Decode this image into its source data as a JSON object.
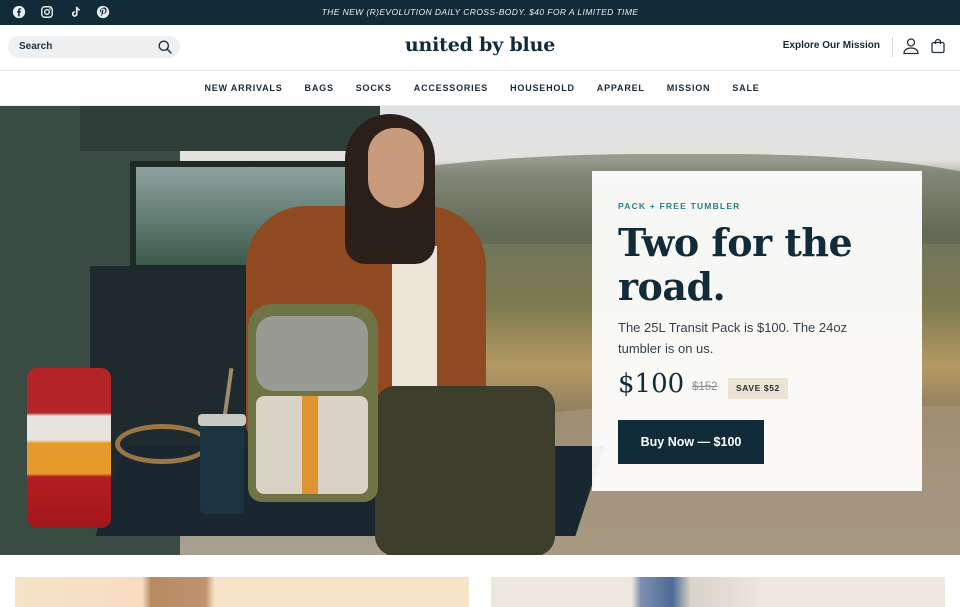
{
  "announcement": {
    "text": "THE NEW (R)EVOLUTION DAILY CROSS-BODY. $40 FOR A LIMITED TIME"
  },
  "social_icons": [
    "facebook-icon",
    "instagram-icon",
    "tiktok-icon",
    "pinterest-icon"
  ],
  "header": {
    "search_label": "Search",
    "logo": "united by blue",
    "mission_link": "Explore Our Mission"
  },
  "nav": {
    "items": [
      "NEW ARRIVALS",
      "BAGS",
      "SOCKS",
      "ACCESSORIES",
      "HOUSEHOLD",
      "APPAREL",
      "MISSION",
      "SALE"
    ]
  },
  "promo": {
    "eyebrow": "PACK + FREE TUMBLER",
    "headline": "Two for the road.",
    "subtext": "The 25L Transit Pack is $100. The 24oz tumbler is on us.",
    "price": "$100",
    "old_price": "$152",
    "save_badge": "SAVE $52",
    "cta": "Buy Now — $100"
  },
  "colors": {
    "brand_navy": "#122b38",
    "accent_teal": "#2e7e86",
    "badge_bg": "#ebe4d3"
  }
}
